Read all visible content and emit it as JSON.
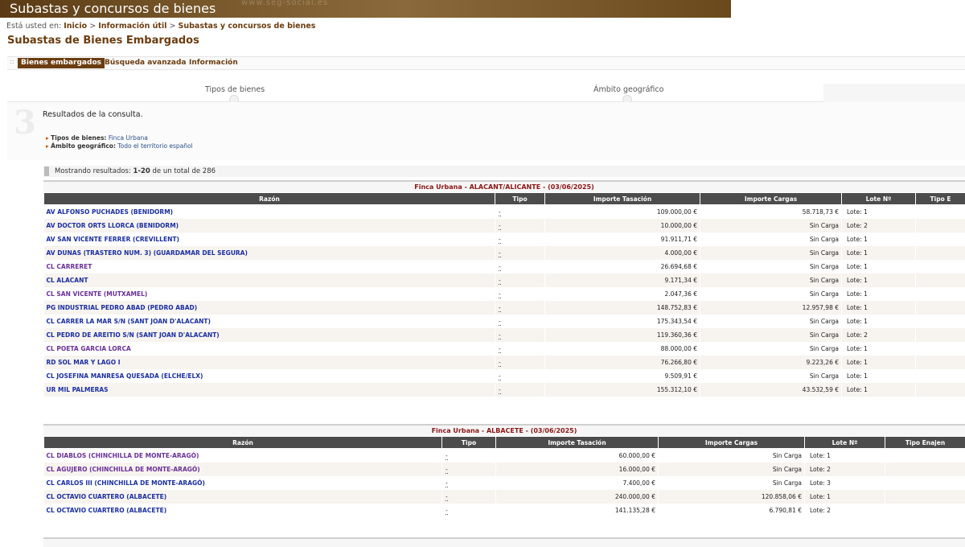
{
  "banner": {
    "title": "Subastas y concursos de bienes",
    "watermark": "www.seg-social.es"
  },
  "breadcrumb": {
    "prefix": "Está usted en:",
    "items": [
      "Inicio",
      "Información útil",
      "Subastas y concursos de bienes"
    ],
    "separator": ">"
  },
  "page_title": "Subastas de Bienes Embargados",
  "tabs": [
    {
      "label": "Bienes embargados",
      "active": true
    },
    {
      "label": "Búsqueda avanzada",
      "active": false
    },
    {
      "label": "Información",
      "active": false
    }
  ],
  "steps": [
    {
      "label": "Tipos de bienes"
    },
    {
      "label": "Ámbito geográfico"
    }
  ],
  "results": {
    "step_number": "3",
    "heading": "Resultados de la consulta.",
    "filters": [
      {
        "key": "Tipos de bienes:",
        "value": "Finca Urbana"
      },
      {
        "key": "Ámbito geográfico:",
        "value": "Todo el territorio español"
      }
    ],
    "count_prefix": "Mostrando resultados:",
    "count_range": "1-20",
    "count_suffix": "de un total de 286"
  },
  "colors": {
    "brand": "#6b3d10",
    "section_title": "#8a1616",
    "header_bg": "#4c4c4c",
    "link": "#1a2fa0",
    "visited_link": "#6a3097"
  },
  "sections": [
    {
      "caption": "Finca Urbana - ALACANT/ALICANTE - (03/06/2025)",
      "headers": [
        "Razón",
        "Tipo",
        "Importe Tasación",
        "Importe Cargas",
        "Lote Nº",
        "Tipo E"
      ],
      "rows": [
        {
          "razon": "AV ALFONSO PUCHADES (BENIDORM)",
          "tipo": "-",
          "tasacion": "109.000,00 €",
          "cargas": "58.718,73 €",
          "lote": "Lote: 1",
          "visited": false
        },
        {
          "razon": "AV DOCTOR ORTS LLORCA (BENIDORM)",
          "tipo": "-",
          "tasacion": "10.000,00 €",
          "cargas": "Sin Carga",
          "lote": "Lote: 2",
          "visited": false
        },
        {
          "razon": "AV SAN VICENTE FERRER (CREVILLENT)",
          "tipo": "-",
          "tasacion": "91.911,71 €",
          "cargas": "Sin Carga",
          "lote": "Lote: 1",
          "visited": false
        },
        {
          "razon": "AV DUNAS (TRASTERO NUM. 3) (GUARDAMAR DEL SEGURA)",
          "tipo": "-",
          "tasacion": "4.000,00 €",
          "cargas": "Sin Carga",
          "lote": "Lote: 1",
          "visited": false
        },
        {
          "razon": "CL CARRERET",
          "tipo": "-",
          "tasacion": "26.694,68 €",
          "cargas": "Sin Carga",
          "lote": "Lote: 1",
          "visited": true
        },
        {
          "razon": "CL ALACANT",
          "tipo": "-",
          "tasacion": "9.171,34 €",
          "cargas": "Sin Carga",
          "lote": "Lote: 1",
          "visited": false
        },
        {
          "razon": "CL SAN VICENTE (MUTXAMEL)",
          "tipo": "-",
          "tasacion": "2.047,36 €",
          "cargas": "Sin Carga",
          "lote": "Lote: 1",
          "visited": true
        },
        {
          "razon": "PG INDUSTRIAL PEDRO ABAD (PEDRO ABAD)",
          "tipo": "-",
          "tasacion": "148.752,83 €",
          "cargas": "12.957,98 €",
          "lote": "Lote: 1",
          "visited": false
        },
        {
          "razon": "CL CARRER LA MAR S/N (SANT JOAN D'ALACANT)",
          "tipo": "-",
          "tasacion": "175.343,54 €",
          "cargas": "Sin Carga",
          "lote": "Lote: 1",
          "visited": false
        },
        {
          "razon": "CL PEDRO DE AREITIO S/N (SANT JOAN D'ALACANT)",
          "tipo": "-",
          "tasacion": "119.360,36 €",
          "cargas": "Sin Carga",
          "lote": "Lote: 2",
          "visited": false
        },
        {
          "razon": "CL POETA GARCIA LORCA",
          "tipo": "-",
          "tasacion": "88.000,00 €",
          "cargas": "Sin Carga",
          "lote": "Lote: 1",
          "visited": true
        },
        {
          "razon": "RD SOL MAR Y LAGO I",
          "tipo": "-",
          "tasacion": "76.266,80 €",
          "cargas": "9.223,26 €",
          "lote": "Lote: 1",
          "visited": false
        },
        {
          "razon": "CL JOSEFINA MANRESA QUESADA (ELCHE/ELX)",
          "tipo": "-",
          "tasacion": "9.509,91 €",
          "cargas": "Sin Carga",
          "lote": "Lote: 1",
          "visited": false
        },
        {
          "razon": "UR MIL PALMERAS",
          "tipo": "-",
          "tasacion": "155.312,10 €",
          "cargas": "43.532,59 €",
          "lote": "Lote: 1",
          "visited": false
        }
      ]
    },
    {
      "caption": "Finca Urbana - ALBACETE - (03/06/2025)",
      "headers": [
        "Razón",
        "Tipo",
        "Importe Tasación",
        "Importe Cargas",
        "Lote Nº",
        "Tipo Enajen"
      ],
      "rows": [
        {
          "razon": "CL DIABLOS (CHINCHILLA DE MONTE-ARAGÓ)",
          "tipo": "-",
          "tasacion": "60.000,00 €",
          "cargas": "Sin Carga",
          "lote": "Lote: 1",
          "visited": true
        },
        {
          "razon": "CL AGUJERO (CHINCHILLA DE MONTE-ARAGÓ)",
          "tipo": "-",
          "tasacion": "16.000,00 €",
          "cargas": "Sin Carga",
          "lote": "Lote: 2",
          "visited": true
        },
        {
          "razon": "CL CARLOS III (CHINCHILLA DE MONTE-ARAGÓ)",
          "tipo": "-",
          "tasacion": "7.400,00 €",
          "cargas": "Sin Carga",
          "lote": "Lote: 3",
          "visited": false
        },
        {
          "razon": "CL OCTAVIO CUARTERO (ALBACETE)",
          "tipo": "-",
          "tasacion": "240.000,00 €",
          "cargas": "120.858,06 €",
          "lote": "Lote: 1",
          "visited": false
        },
        {
          "razon": "CL OCTAVIO CUARTERO (ALBACETE)",
          "tipo": "-",
          "tasacion": "141.135,28 €",
          "cargas": "6.790,81 €",
          "lote": "Lote: 2",
          "visited": false
        }
      ]
    }
  ]
}
